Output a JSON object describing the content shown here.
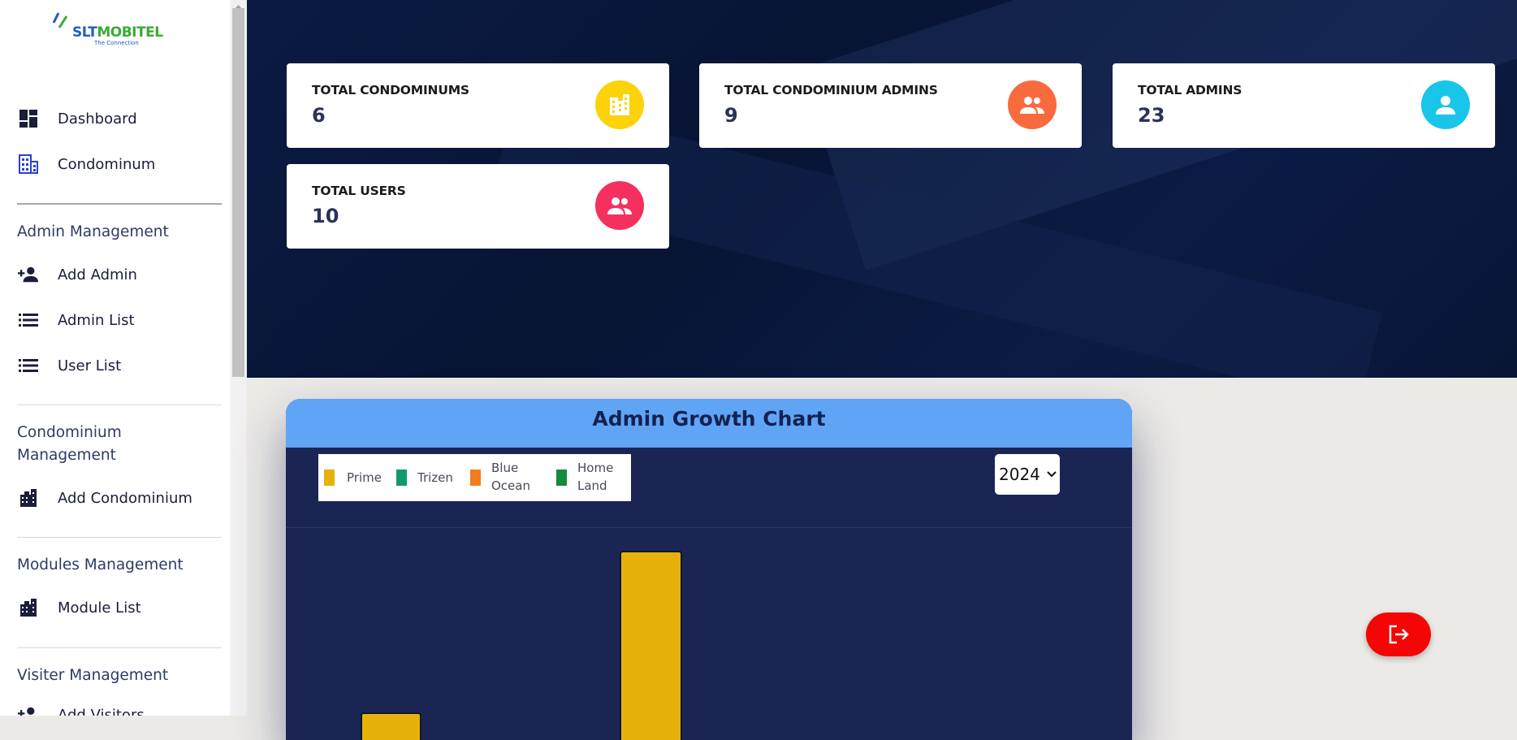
{
  "brand": {
    "name_part1": "SLT",
    "name_part2": "MOBITEL",
    "tagline": "The Connection",
    "color_primary": "#1f5fbf",
    "color_secondary": "#3aaa35"
  },
  "sidebar": {
    "items": [
      {
        "label": "Dashboard",
        "icon": "dashboard-icon"
      },
      {
        "label": "Condominum",
        "icon": "building-icon"
      }
    ],
    "sections": [
      {
        "title": "Admin Management",
        "items": [
          {
            "label": "Add Admin",
            "icon": "person-add-icon"
          },
          {
            "label": "Admin List",
            "icon": "list-icon"
          },
          {
            "label": "User List",
            "icon": "list-icon"
          }
        ]
      },
      {
        "title": "Condominium Management",
        "items": [
          {
            "label": "Add Condominium",
            "icon": "apartment-icon"
          }
        ]
      },
      {
        "title": "Modules Management",
        "items": [
          {
            "label": "Module List",
            "icon": "apartment-icon"
          }
        ]
      },
      {
        "title": "Visiter Management",
        "items": [
          {
            "label": "Add Visitors",
            "icon": "person-add-icon"
          }
        ]
      }
    ]
  },
  "stats": [
    {
      "title": "TOTAL CONDOMINUMS",
      "value": "6",
      "icon": "building-icon",
      "color": "#fcd20a"
    },
    {
      "title": "TOTAL CONDOMINIUM ADMINS",
      "value": "9",
      "icon": "group-icon",
      "color": "#fa6a3f"
    },
    {
      "title": "TOTAL ADMINS",
      "value": "23",
      "icon": "person-icon",
      "color": "#19c5e8"
    },
    {
      "title": "TOTAL USERS",
      "value": "10",
      "icon": "group-icon",
      "color": "#f5305e"
    }
  ],
  "chart_panel": {
    "title": "Admin Growth Chart",
    "year_selected": "2024",
    "legend": [
      {
        "label_line1": "Prime",
        "label_line2": "",
        "color": "#e6b10a"
      },
      {
        "label_line1": "Trizen",
        "label_line2": "",
        "color": "#11996e"
      },
      {
        "label_line1": "Blue",
        "label_line2": "Ocean",
        "color": "#f57b1c"
      },
      {
        "label_line1": "Home",
        "label_line2": "Land",
        "color": "#138a3c"
      }
    ]
  },
  "chart_data": {
    "type": "bar",
    "title": "Admin Growth Chart",
    "series": [
      {
        "name": "Prime",
        "color": "#e6b10a",
        "values_visible": [
          1,
          5
        ]
      }
    ],
    "note_visible": "chart is cut off at the bottom of the viewport; axes and categories are not visible"
  },
  "actions": {
    "logout_icon": "logout-icon",
    "logout_color": "#f50505"
  }
}
